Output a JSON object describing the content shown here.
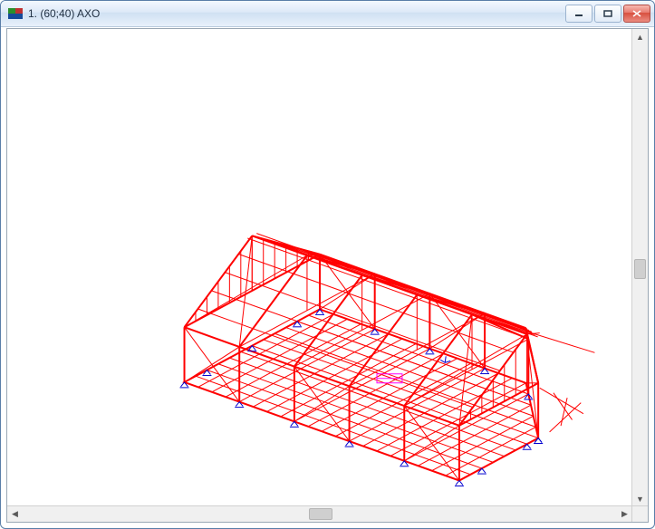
{
  "window": {
    "title": "1.  (60;40)  AXO",
    "icon_name": "app-icon"
  },
  "controls": {
    "minimize_tooltip": "Minimize",
    "maximize_tooltip": "Maximize",
    "close_tooltip": "Close"
  },
  "view": {
    "projection": "AXO",
    "angles": "(60;40)",
    "colors": {
      "wireframe": "#ff0000",
      "supports": "#0000d0",
      "annotation": "#ff00ff",
      "background": "#ffffff"
    }
  },
  "scroll": {
    "v_thumb_pos_pct": 50,
    "h_thumb_pos_pct": 50
  }
}
